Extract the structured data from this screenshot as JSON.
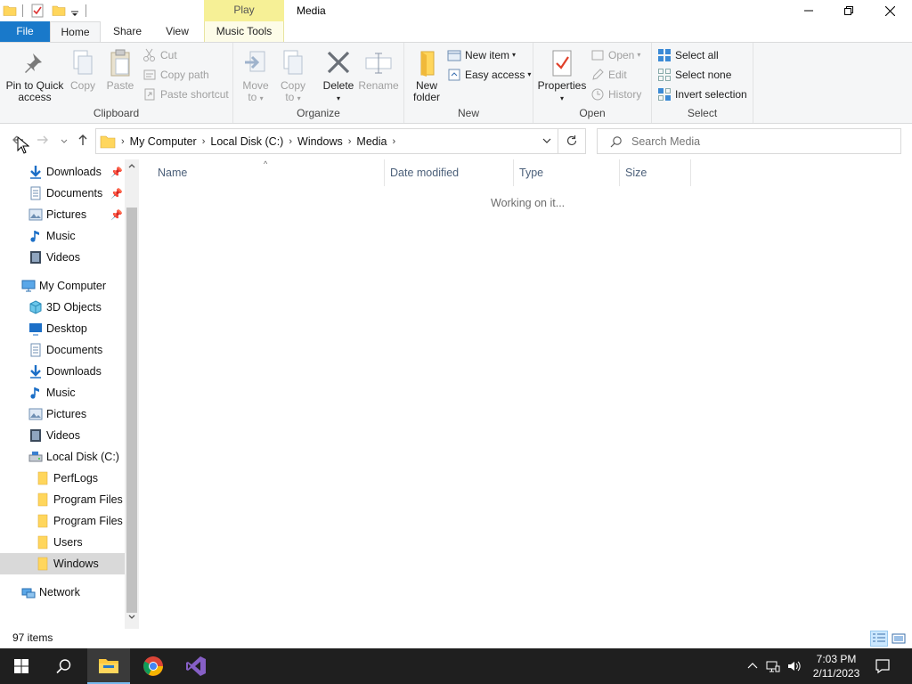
{
  "window": {
    "title": "Media",
    "context_tab_header": "Play"
  },
  "ribbon_tabs": {
    "file": "File",
    "home": "Home",
    "share": "Share",
    "view": "View",
    "music_tools": "Music Tools"
  },
  "clipboard": {
    "label": "Clipboard",
    "pin": "Pin to Quick access",
    "pin_line1": "Pin to Quick",
    "pin_line2": "access",
    "copy": "Copy",
    "paste": "Paste",
    "cut": "Cut",
    "copy_path": "Copy path",
    "paste_shortcut": "Paste shortcut"
  },
  "organize": {
    "label": "Organize",
    "move_to_line1": "Move",
    "move_to_line2": "to",
    "copy_to_line1": "Copy",
    "copy_to_line2": "to",
    "delete": "Delete",
    "rename": "Rename"
  },
  "new_group": {
    "label": "New",
    "new_folder_line1": "New",
    "new_folder_line2": "folder",
    "new_item": "New item",
    "easy_access": "Easy access"
  },
  "open_group": {
    "label": "Open",
    "properties": "Properties",
    "open": "Open",
    "edit": "Edit",
    "history": "History"
  },
  "select_group": {
    "label": "Select",
    "select_all": "Select all",
    "select_none": "Select none",
    "invert_selection": "Invert selection"
  },
  "address": {
    "crumbs": [
      "My Computer",
      "Local Disk (C:)",
      "Windows",
      "Media"
    ]
  },
  "search": {
    "placeholder": "Search Media"
  },
  "nav_pane": {
    "quick_access": [
      "Downloads",
      "Documents",
      "Pictures",
      "Music",
      "Videos"
    ],
    "my_computer": "My Computer",
    "computer_items": [
      "3D Objects",
      "Desktop",
      "Documents",
      "Downloads",
      "Music",
      "Pictures",
      "Videos"
    ],
    "local_disk": "Local Disk (C:)",
    "disk_items": [
      "PerfLogs",
      "Program Files",
      "Program Files (",
      "Users",
      "Windows"
    ],
    "network": "Network"
  },
  "columns": {
    "name": "Name",
    "date_modified": "Date modified",
    "type": "Type",
    "size": "Size"
  },
  "content": {
    "working": "Working on it..."
  },
  "status": {
    "items": "97 items"
  },
  "taskbar": {
    "time": "7:03 PM",
    "date": "2/11/2023"
  },
  "colors": {
    "accent": "#1979ca",
    "context_tab": "#f6f096",
    "folder": "#ffd65c",
    "taskbar": "#1f1f1f"
  }
}
